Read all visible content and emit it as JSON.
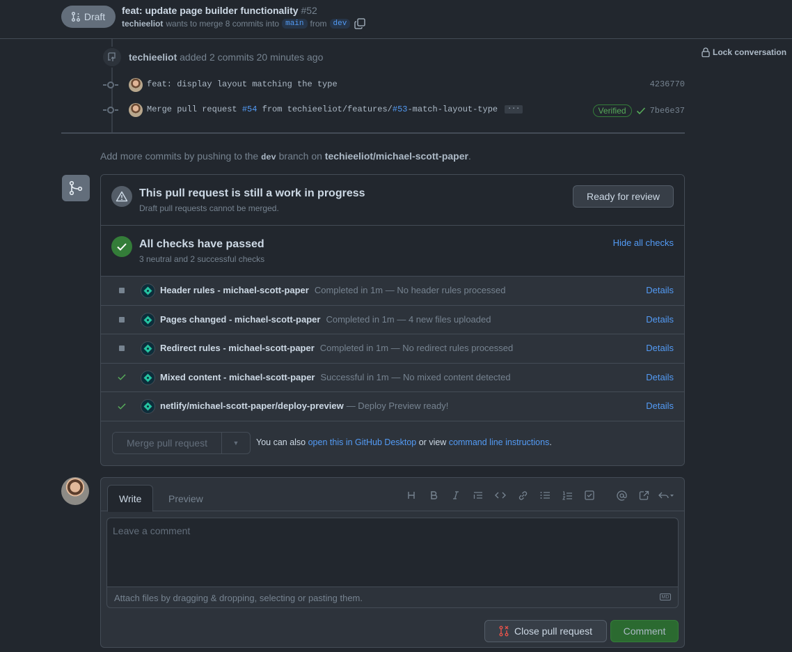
{
  "header": {
    "draft_label": "Draft",
    "title": "feat: update page builder functionality",
    "number": "#52",
    "author": "techieeliot",
    "merge_text": "wants to merge 8 commits into",
    "base_branch": "main",
    "from_text": "from",
    "head_branch": "dev"
  },
  "lock_label": "Lock conversation",
  "timeline": {
    "push_author": "techieeliot",
    "push_text": "added 2 commits 20 minutes ago",
    "commits": [
      {
        "message": "feat: display layout matching the type",
        "sha": "4236770"
      },
      {
        "message_prefix": "Merge pull request ",
        "pr_link": "#54",
        "message_mid": " from techieeliot/features/",
        "issue_link": "#53",
        "message_suffix": "-match-layout-type",
        "ellipsis": "···",
        "verified": "Verified",
        "sha": "7be6e37"
      }
    ]
  },
  "hint": {
    "prefix": "Add more commits by pushing to the",
    "branch": "dev",
    "mid": "branch on",
    "repo": "techieeliot/michael-scott-paper",
    "suffix": "."
  },
  "merge_box": {
    "wip_title": "This pull request is still a work in progress",
    "wip_subtitle": "Draft pull requests cannot be merged.",
    "ready_button": "Ready for review",
    "checks_title": "All checks have passed",
    "checks_subtitle": "3 neutral and 2 successful checks",
    "hide_checks": "Hide all checks",
    "checks": [
      {
        "status": "neutral",
        "name": "Header rules - michael-scott-paper",
        "desc": "Completed in 1m — No header rules processed",
        "details": "Details"
      },
      {
        "status": "neutral",
        "name": "Pages changed - michael-scott-paper",
        "desc": "Completed in 1m — 4 new files uploaded",
        "details": "Details"
      },
      {
        "status": "neutral",
        "name": "Redirect rules - michael-scott-paper",
        "desc": "Completed in 1m — No redirect rules processed",
        "details": "Details"
      },
      {
        "status": "success",
        "name": "Mixed content - michael-scott-paper",
        "desc": "Successful in 1m — No mixed content detected",
        "details": "Details"
      },
      {
        "status": "success",
        "name": "netlify/michael-scott-paper/deploy-preview",
        "desc": "— Deploy Preview ready!",
        "details": "Details"
      }
    ],
    "merge_button": "Merge pull request",
    "also_text": "You can also",
    "desktop_link": "open this in GitHub Desktop",
    "or_text": "or view",
    "cli_link": "command line instructions",
    "period": "."
  },
  "comment": {
    "tab_write": "Write",
    "tab_preview": "Preview",
    "placeholder": "Leave a comment",
    "attach_text": "Attach files by dragging & dropping, selecting or pasting them.",
    "md_badge": "MD",
    "close_button": "Close pull request",
    "comment_button": "Comment"
  },
  "colors": {
    "background": "#22272e",
    "accent_link": "#539bf5",
    "success": "#347d39",
    "draft": "#636e7b"
  }
}
